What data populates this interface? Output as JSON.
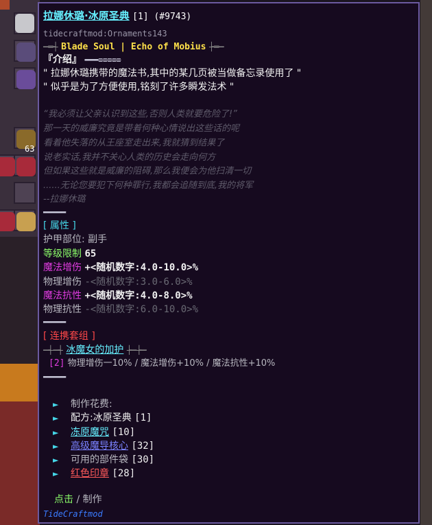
{
  "tooltip": {
    "title": "拉娜休璐·冰原圣典",
    "title_meta": "[1] (#9743)",
    "mod_id": "tidecraftmod:Ornaments143",
    "subtitle_left_deco": "─═┤",
    "subtitle": "Blade Soul | Echo of Mobius",
    "subtitle_right_deco": "├═─",
    "intro_header": "『介绍』",
    "intro_deco": "═══≡≡≡≡≡",
    "intro_lines": [
      "\" 拉娜休璐携带的魔法书,其中的某几页被当做备忘录使用了 \"",
      "\" 似乎是为了方便使用,铭刻了许多瞬发法术 \""
    ],
    "lore_lines": [
      "“我必须让父亲认识到这些,否则人类就要危险了!”",
      "那一天的威廉究竟是带着何种心情说出这些话的呢",
      "看着他失落的从王座室走出来,我就猜到结果了",
      "说老实话,我并不关心人类的历史会走向何方",
      "但如果这些就是威廉的阻碍,那么我便会为他扫清一切",
      "......无论您要犯下何种罪行,我都会追随到底,我的将军",
      "--拉娜休璐"
    ],
    "separator": "═════",
    "attributes_header": "[ 属性 ]",
    "armor_slot_label": "护甲部位:",
    "armor_slot_value": "副手",
    "level_label": "等级限制",
    "level_value": "65",
    "stats": [
      {
        "label": "魔法增伤",
        "value": "+<随机数字:4.0-10.0>%",
        "active": true
      },
      {
        "label": "物理增伤",
        "value": "-<随机数字:3.0-6.0>%",
        "active": false
      },
      {
        "label": "魔法抗性",
        "value": "+<随机数字:4.0-8.0>%",
        "active": true
      },
      {
        "label": "物理抗性",
        "value": "-<随机数字:6.0-10.0>%",
        "active": false
      }
    ],
    "set_header": "[ 连携套组 ]",
    "set_left_deco": "─┤─┤",
    "set_name": "冰魔女的加护",
    "set_right_deco": "├─├─",
    "set_bonus_count": "[2]",
    "set_bonus_text": "物理增伤一10% / 魔法增伤+10% / 魔法抗性+10%",
    "craft_header": "制作花费:",
    "craft_items": [
      {
        "text": "配方:冰原圣典",
        "count": "[1]",
        "style": "white"
      },
      {
        "text": "冻原魔咒",
        "count": "[10]",
        "style": "link-cyan"
      },
      {
        "text": "高级魔导核心",
        "count": "[32]",
        "style": "link-blue"
      },
      {
        "text": "可用的部件袋",
        "count": "[30]",
        "style": "gray"
      },
      {
        "text": "红色印章",
        "count": "[28]",
        "style": "link-red"
      }
    ],
    "action_click": "点击",
    "action_sep": "/",
    "action_craft": "制作",
    "mod_name": "TideCraftmod"
  },
  "inventory": {
    "stack_count": "63"
  },
  "colors": {
    "panel_bg": "#160a1f",
    "panel_border": "#6b5aa0",
    "title": "#66f0ff",
    "accent_yellow": "#ffe14a",
    "magic": "#e03ce0",
    "level": "#8cff6a",
    "set": "#ff4848"
  }
}
